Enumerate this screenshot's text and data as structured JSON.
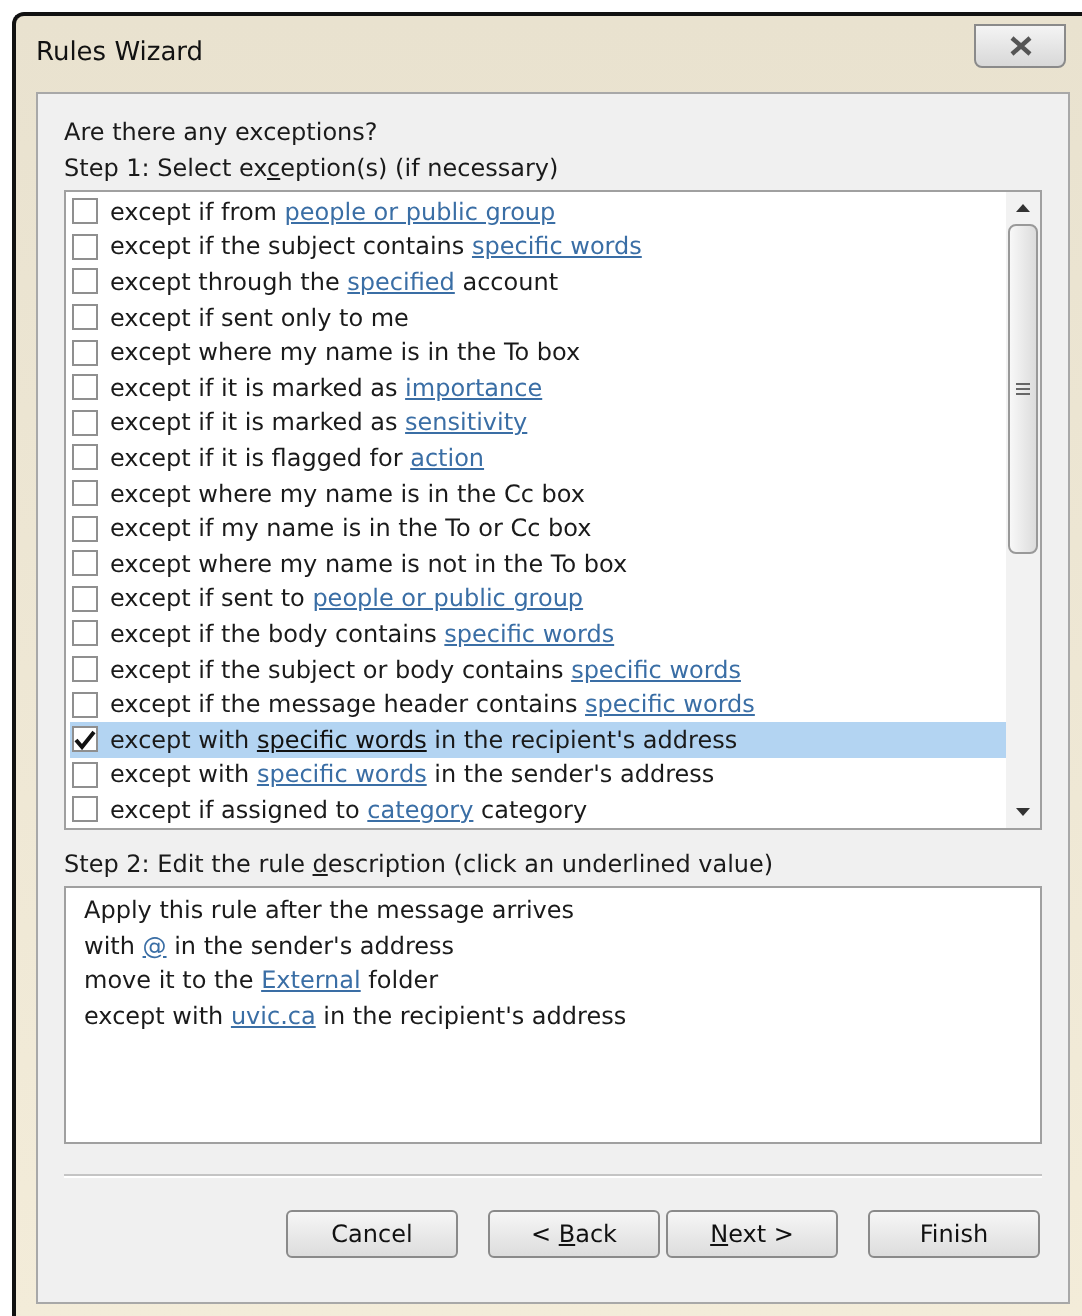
{
  "window": {
    "title": "Rules Wizard"
  },
  "question": "Are there any exceptions?",
  "step1_label": [
    {
      "text": "Step 1: Select ex",
      "underline": false
    },
    {
      "text": "c",
      "underline": true
    },
    {
      "text": "eption(s) (if necessary)",
      "underline": false
    }
  ],
  "exceptions": [
    {
      "checked": false,
      "selected": false,
      "parts": [
        {
          "kind": "text",
          "text": "except if from "
        },
        {
          "kind": "link",
          "text": "people or public group"
        }
      ]
    },
    {
      "checked": false,
      "selected": false,
      "parts": [
        {
          "kind": "text",
          "text": "except if the subject contains "
        },
        {
          "kind": "link",
          "text": "specific words"
        }
      ]
    },
    {
      "checked": false,
      "selected": false,
      "parts": [
        {
          "kind": "text",
          "text": "except through the "
        },
        {
          "kind": "link",
          "text": "specified"
        },
        {
          "kind": "text",
          "text": " account"
        }
      ]
    },
    {
      "checked": false,
      "selected": false,
      "parts": [
        {
          "kind": "text",
          "text": "except if sent only to me"
        }
      ]
    },
    {
      "checked": false,
      "selected": false,
      "parts": [
        {
          "kind": "text",
          "text": "except where my name is in the To box"
        }
      ]
    },
    {
      "checked": false,
      "selected": false,
      "parts": [
        {
          "kind": "text",
          "text": "except if it is marked as "
        },
        {
          "kind": "link",
          "text": "importance"
        }
      ]
    },
    {
      "checked": false,
      "selected": false,
      "parts": [
        {
          "kind": "text",
          "text": "except if it is marked as "
        },
        {
          "kind": "link",
          "text": "sensitivity"
        }
      ]
    },
    {
      "checked": false,
      "selected": false,
      "parts": [
        {
          "kind": "text",
          "text": "except if it is flagged for "
        },
        {
          "kind": "link",
          "text": "action"
        }
      ]
    },
    {
      "checked": false,
      "selected": false,
      "parts": [
        {
          "kind": "text",
          "text": "except where my name is in the Cc box"
        }
      ]
    },
    {
      "checked": false,
      "selected": false,
      "parts": [
        {
          "kind": "text",
          "text": "except if my name is in the To or Cc box"
        }
      ]
    },
    {
      "checked": false,
      "selected": false,
      "parts": [
        {
          "kind": "text",
          "text": "except where my name is not in the To box"
        }
      ]
    },
    {
      "checked": false,
      "selected": false,
      "parts": [
        {
          "kind": "text",
          "text": "except if sent to "
        },
        {
          "kind": "link",
          "text": "people or public group"
        }
      ]
    },
    {
      "checked": false,
      "selected": false,
      "parts": [
        {
          "kind": "text",
          "text": "except if the body contains "
        },
        {
          "kind": "link",
          "text": "specific words"
        }
      ]
    },
    {
      "checked": false,
      "selected": false,
      "parts": [
        {
          "kind": "text",
          "text": "except if the subject or body contains "
        },
        {
          "kind": "link",
          "text": "specific words"
        }
      ]
    },
    {
      "checked": false,
      "selected": false,
      "parts": [
        {
          "kind": "text",
          "text": "except if the message header contains "
        },
        {
          "kind": "link",
          "text": "specific words"
        }
      ]
    },
    {
      "checked": true,
      "selected": true,
      "parts": [
        {
          "kind": "text",
          "text": "except with "
        },
        {
          "kind": "link",
          "text": "specific words"
        },
        {
          "kind": "text",
          "text": " in the recipient's address"
        }
      ]
    },
    {
      "checked": false,
      "selected": false,
      "parts": [
        {
          "kind": "text",
          "text": "except with "
        },
        {
          "kind": "link",
          "text": "specific words"
        },
        {
          "kind": "text",
          "text": " in the sender's address"
        }
      ]
    },
    {
      "checked": false,
      "selected": false,
      "parts": [
        {
          "kind": "text",
          "text": "except if assigned to "
        },
        {
          "kind": "link",
          "text": "category"
        },
        {
          "kind": "text",
          "text": " category"
        }
      ]
    }
  ],
  "step2_label": [
    {
      "text": "Step 2: Edit the rule ",
      "underline": false
    },
    {
      "text": "d",
      "underline": true
    },
    {
      "text": "escription (click an underlined value)",
      "underline": false
    }
  ],
  "description": [
    {
      "parts": [
        {
          "kind": "text",
          "text": "Apply this rule after the message arrives"
        }
      ]
    },
    {
      "parts": [
        {
          "kind": "text",
          "text": "with "
        },
        {
          "kind": "link",
          "text": "@"
        },
        {
          "kind": "text",
          "text": " in the sender's address"
        }
      ]
    },
    {
      "parts": [
        {
          "kind": "text",
          "text": "move it to the "
        },
        {
          "kind": "link",
          "text": "External"
        },
        {
          "kind": "text",
          "text": " folder"
        }
      ]
    },
    {
      "parts": [
        {
          "kind": "text",
          "text": "except with "
        },
        {
          "kind": "link",
          "text": "uvic.ca"
        },
        {
          "kind": "text",
          "text": " in the recipient's address"
        }
      ]
    }
  ],
  "buttons": [
    {
      "label": [
        {
          "text": "Cancel",
          "underline": false
        }
      ]
    },
    {
      "label": [
        {
          "text": "< ",
          "underline": false
        },
        {
          "text": "B",
          "underline": true
        },
        {
          "text": "ack",
          "underline": false
        }
      ]
    },
    {
      "label": [
        {
          "text": "N",
          "underline": true
        },
        {
          "text": "ext >",
          "underline": false
        }
      ]
    },
    {
      "label": [
        {
          "text": "Finish",
          "underline": false
        }
      ]
    }
  ]
}
